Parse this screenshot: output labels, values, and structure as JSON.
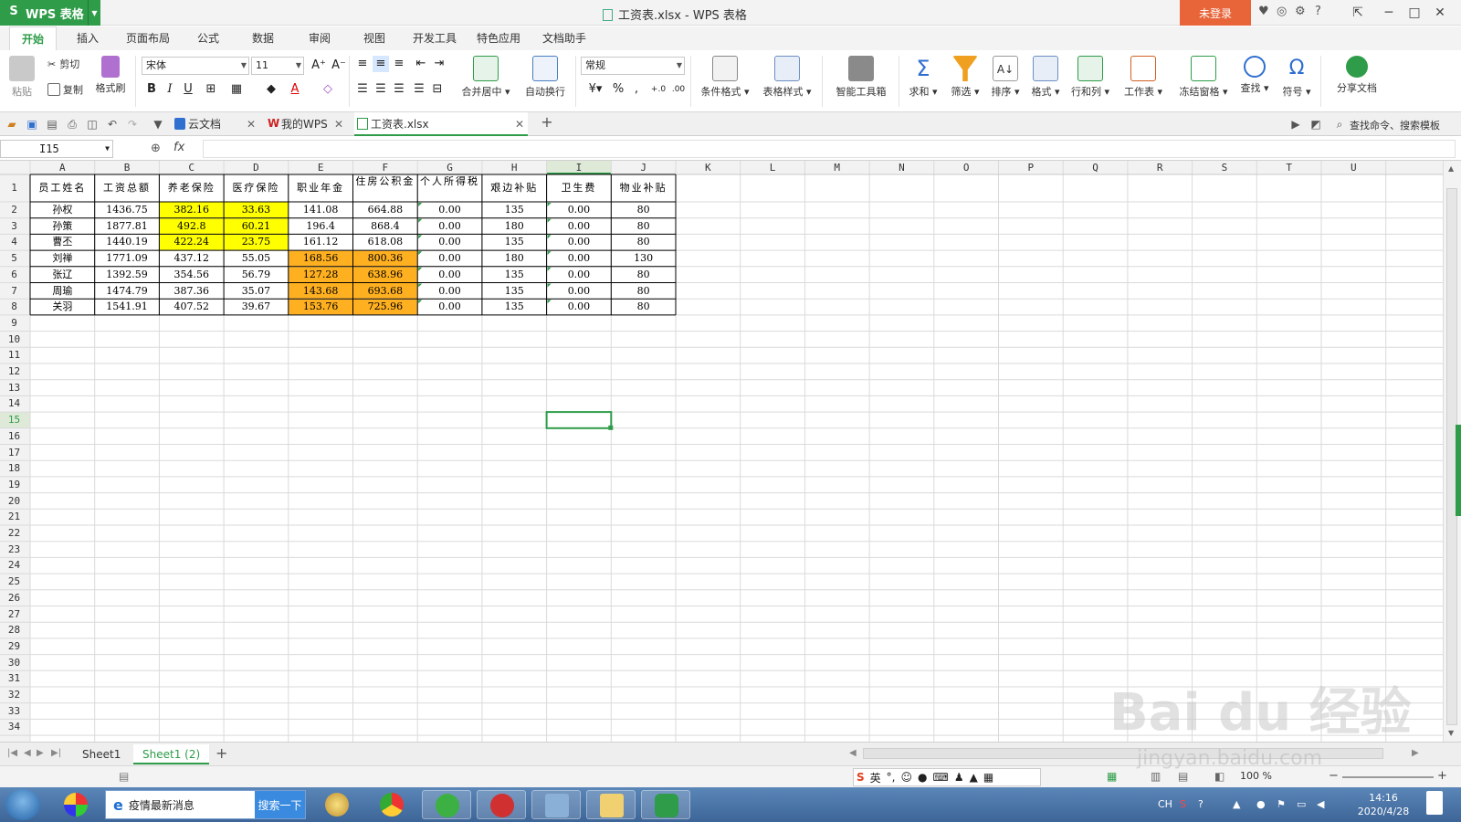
{
  "app": {
    "logo_label": "WPS 表格",
    "window_title": "工资表.xlsx - WPS 表格",
    "login_label": "未登录"
  },
  "ribbon_tabs": [
    "开始",
    "插入",
    "页面布局",
    "公式",
    "数据",
    "审阅",
    "视图",
    "开发工具",
    "特色应用",
    "文档助手"
  ],
  "toolbar": {
    "paste": "粘贴",
    "cut": "剪切",
    "copy": "复制",
    "format_painter": "格式刷",
    "font_name": "宋体",
    "font_size": "11",
    "merge_center": "合并居中",
    "wrap_text": "自动换行",
    "number_format": "常规",
    "conditional_format": "条件格式",
    "table_style": "表格样式",
    "smart_toolbox": "智能工具箱",
    "sum": "求和",
    "filter": "筛选",
    "sort": "排序",
    "format": "格式",
    "row_col": "行和列",
    "worksheet": "工作表",
    "freeze": "冻结窗格",
    "find": "查找",
    "symbol": "符号",
    "share": "分享文档"
  },
  "doc_tabs": [
    {
      "label": "云文档"
    },
    {
      "label": "我的WPS"
    },
    {
      "label": "工资表.xlsx"
    }
  ],
  "search_commands": "查找命令、搜索模板",
  "formula_bar": {
    "name_box": "I15",
    "fx": "fx",
    "formula": ""
  },
  "sheet": {
    "columns": [
      "A",
      "B",
      "C",
      "D",
      "E",
      "F",
      "G",
      "H",
      "I",
      "J",
      "K",
      "L",
      "M",
      "N",
      "O",
      "P",
      "Q",
      "R",
      "S",
      "T",
      "U"
    ],
    "header_row": [
      "员工姓名",
      "工资总额",
      "养老保险",
      "医疗保险",
      "职业年金",
      "住房公积金",
      "个人所得税",
      "艰边补贴",
      "卫生费",
      "物业补贴"
    ],
    "rows": [
      [
        "孙权",
        "1436.75",
        "382.16",
        "33.63",
        "141.08",
        "664.88",
        "0.00",
        "135",
        "0.00",
        "80"
      ],
      [
        "孙策",
        "1877.81",
        "492.8",
        "60.21",
        "196.4",
        "868.4",
        "0.00",
        "180",
        "0.00",
        "80"
      ],
      [
        "曹丕",
        "1440.19",
        "422.24",
        "23.75",
        "161.12",
        "618.08",
        "0.00",
        "135",
        "0.00",
        "80"
      ],
      [
        "刘禅",
        "1771.09",
        "437.12",
        "55.05",
        "168.56",
        "800.36",
        "0.00",
        "180",
        "0.00",
        "130"
      ],
      [
        "张辽",
        "1392.59",
        "354.56",
        "56.79",
        "127.28",
        "638.96",
        "0.00",
        "135",
        "0.00",
        "80"
      ],
      [
        "周瑜",
        "1474.79",
        "387.36",
        "35.07",
        "143.68",
        "693.68",
        "0.00",
        "135",
        "0.00",
        "80"
      ],
      [
        "关羽",
        "1541.91",
        "407.52",
        "39.67",
        "153.76",
        "725.96",
        "0.00",
        "135",
        "0.00",
        "80"
      ]
    ],
    "highlight_yellow": "#ffff00",
    "highlight_orange": "#ffb020",
    "selected_cell": "I15"
  },
  "sheet_tabs": [
    "Sheet1",
    "Sheet1 (2)"
  ],
  "status": {
    "zoom": "100 %"
  },
  "ime": {
    "lang": "英"
  },
  "taskbar": {
    "search_text": "疫情最新消息",
    "search_button": "搜索一下",
    "time": "14:16",
    "date": "2020/4/28",
    "lang": "CH"
  },
  "watermark": {
    "brand": "Bai du 经验",
    "url": "jingyan.baidu.com"
  },
  "colors": {
    "wps_green": "#2e9c48",
    "login_orange": "#e8653a"
  }
}
